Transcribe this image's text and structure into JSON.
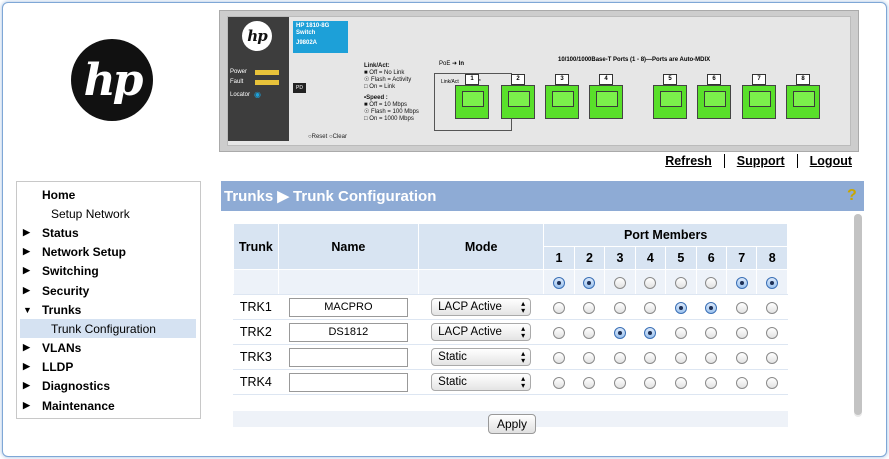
{
  "device": {
    "model": "HP 1810-8G",
    "model_line2": "Switch",
    "part": "J9802A",
    "leds": [
      "Power",
      "Fault",
      "Locator"
    ],
    "pd_label": "PD",
    "legend_link": "Link/Act:",
    "legend_off": "Off = No Link",
    "legend_flash": "Flash = Activity",
    "legend_on": "On = Link",
    "legend_speed": "•Speed :",
    "legend_s1": "Off = 10 Mbps",
    "legend_s2": "Flash = 100 Mbps",
    "legend_s3": "On = 1000 Mbps",
    "reset": "Reset",
    "clear": "Clear",
    "poe": "PoE",
    "poe_in": "In",
    "link_act": "Link/Act",
    "spd": "Spd*",
    "ports_title": "10/100/1000Base-T Ports (1 - 8)—Ports are Auto-MDIX",
    "port_numbers": [
      "1",
      "2",
      "3",
      "4",
      "5",
      "6",
      "7",
      "8"
    ]
  },
  "toplinks": {
    "refresh": "Refresh",
    "support": "Support",
    "logout": "Logout"
  },
  "nav": {
    "home": "Home",
    "setup_network": "Setup Network",
    "status": "Status",
    "network_setup": "Network Setup",
    "switching": "Switching",
    "security": "Security",
    "trunks": "Trunks",
    "trunk_configuration": "Trunk Configuration",
    "vlans": "VLANs",
    "lldp": "LLDP",
    "diagnostics": "Diagnostics",
    "maintenance": "Maintenance"
  },
  "page": {
    "breadcrumb": "Trunks ▶ Trunk Configuration",
    "help": "?"
  },
  "table": {
    "headers": {
      "trunk": "Trunk",
      "name": "Name",
      "mode": "Mode",
      "port_members": "Port Members"
    },
    "ports": [
      "1",
      "2",
      "3",
      "4",
      "5",
      "6",
      "7",
      "8"
    ],
    "default_row": [
      true,
      true,
      false,
      false,
      false,
      false,
      true,
      true
    ],
    "rows": [
      {
        "trunk": "TRK1",
        "name": "MACPRO",
        "mode": "LACP Active",
        "members": [
          false,
          false,
          false,
          false,
          true,
          true,
          false,
          false
        ]
      },
      {
        "trunk": "TRK2",
        "name": "DS1812",
        "mode": "LACP Active",
        "members": [
          false,
          false,
          true,
          true,
          false,
          false,
          false,
          false
        ]
      },
      {
        "trunk": "TRK3",
        "name": "",
        "mode": "Static",
        "members": [
          false,
          false,
          false,
          false,
          false,
          false,
          false,
          false
        ]
      },
      {
        "trunk": "TRK4",
        "name": "",
        "mode": "Static",
        "members": [
          false,
          false,
          false,
          false,
          false,
          false,
          false,
          false
        ]
      }
    ]
  },
  "apply_label": "Apply"
}
